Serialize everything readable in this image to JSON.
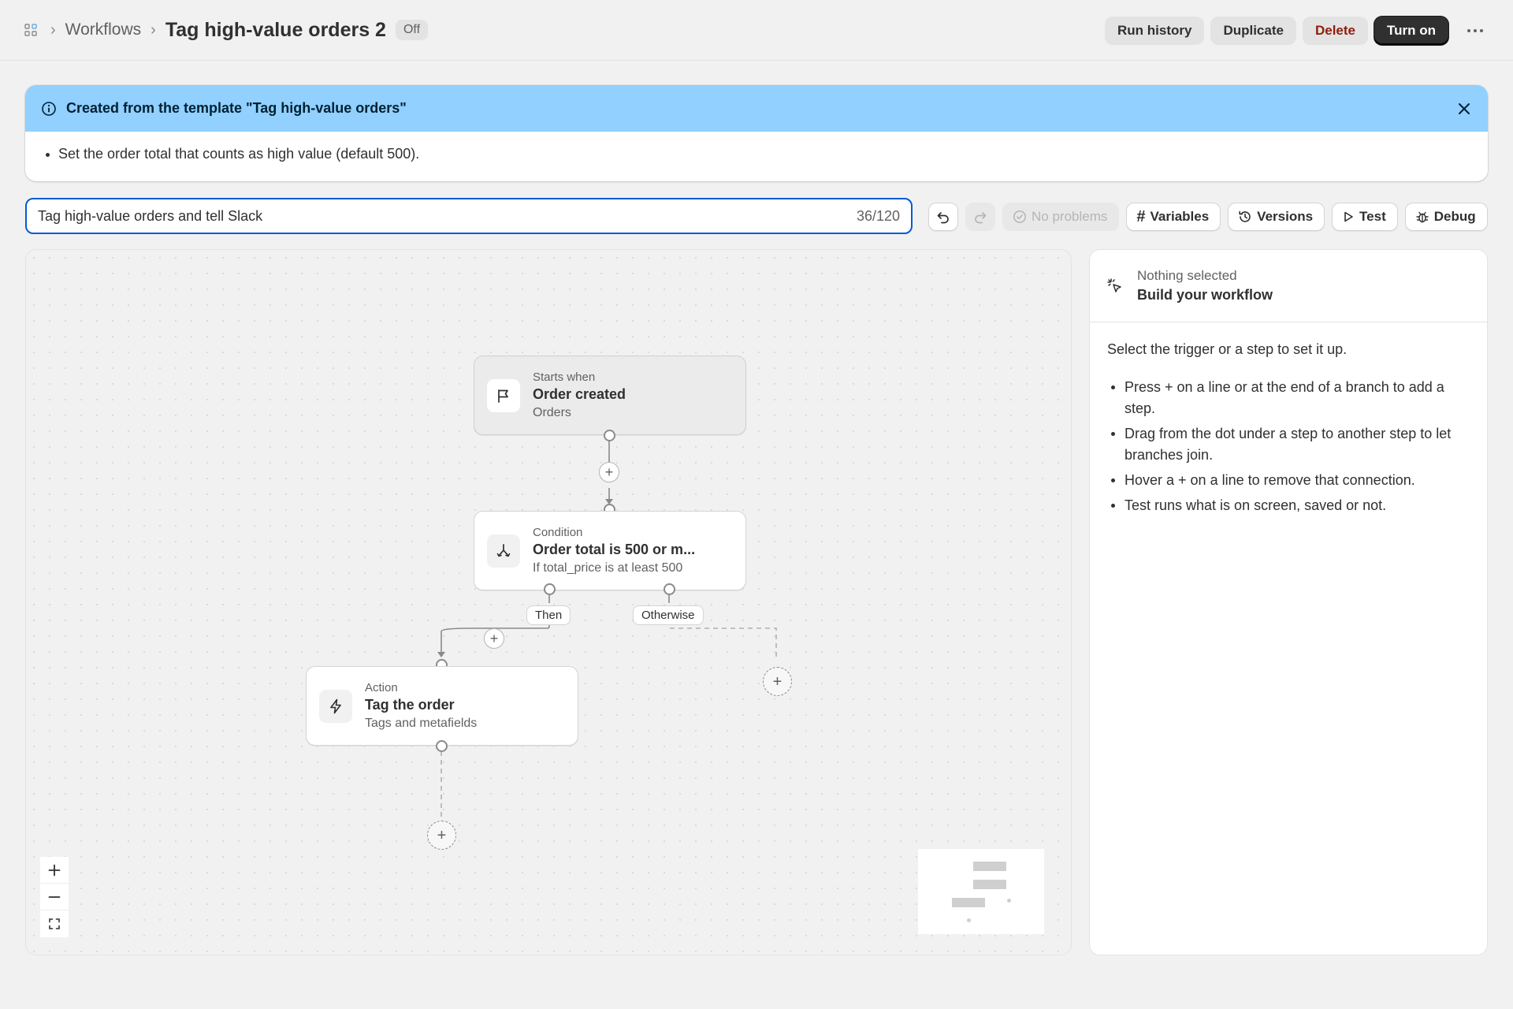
{
  "header": {
    "breadcrumb_parent": "Workflows",
    "title": "Tag high-value orders 2",
    "status_badge": "Off",
    "actions": {
      "run_history": "Run history",
      "duplicate": "Duplicate",
      "delete": "Delete",
      "turn_on": "Turn on"
    }
  },
  "banner": {
    "title": "Created from the template \"Tag high-value orders\"",
    "items": [
      "Set the order total that counts as high value (default 500)."
    ]
  },
  "name_field": {
    "value": "Tag high-value orders and tell Slack",
    "counter": "36/120"
  },
  "toolbar": {
    "status": "No problems",
    "variables": "Variables",
    "versions": "Versions",
    "test": "Test",
    "debug": "Debug"
  },
  "workflow": {
    "trigger": {
      "kind": "Starts when",
      "title": "Order created",
      "subtitle": "Orders"
    },
    "condition": {
      "kind": "Condition",
      "title": "Order total is 500 or m...",
      "subtitle": "If total_price is at least 500"
    },
    "branches": {
      "then": "Then",
      "otherwise": "Otherwise"
    },
    "action": {
      "kind": "Action",
      "title": "Tag the order",
      "subtitle": "Tags and metafields"
    },
    "add_symbol": "+"
  },
  "panel": {
    "kicker": "Nothing selected",
    "title": "Build your workflow",
    "intro": "Select the trigger or a step to set it up.",
    "tips": [
      "Press + on a line or at the end of a branch to add a step.",
      "Drag from the dot under a step to another step to let branches join.",
      "Hover a + on a line to remove that connection.",
      "Test runs what is on screen, saved or not."
    ]
  },
  "colors": {
    "banner_bg": "#91d0ff",
    "focus_ring": "#005bd3",
    "primary_button": "#303030",
    "danger_text": "#8e1f0b"
  }
}
